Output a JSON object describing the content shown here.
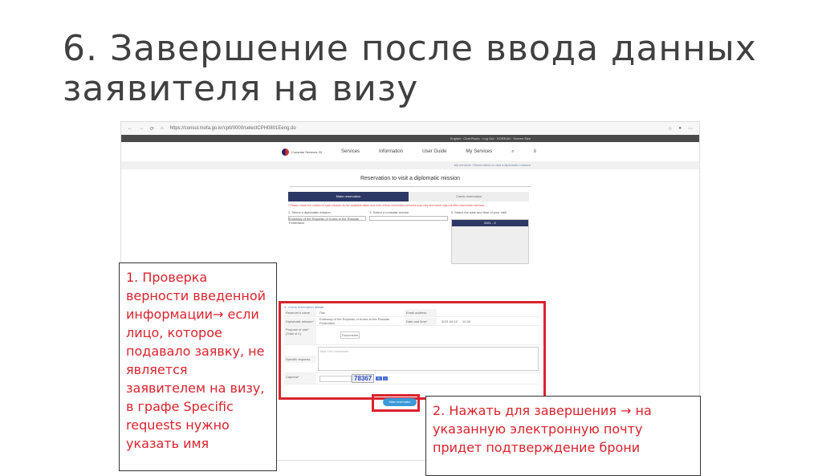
{
  "slide": {
    "title_line1": "6. Завершение после ввода данных",
    "title_line2": "заявителя на визу"
  },
  "browser": {
    "url": "https://consul.mofa.go.kr/cptl/0000/selectCPH0801Eeng.do"
  },
  "site": {
    "top_links": "English · Chat Room · Log Out · KOREAN · Screen Size",
    "logo": "Consular Services 24",
    "nav": [
      "Services",
      "Information",
      "User Guide",
      "My Services"
    ],
    "breadcrumb": "My services / Reservation to visit a diplomatic mission",
    "heading": "Reservation to visit a diplomatic mission",
    "tab_make": "Make reservation",
    "tab_check": "Check reservation",
    "warning": "* Please check the notices of each mission as the available dates and time of their reservation services may vary and some may not offer reservation services.",
    "step1": "1. Select a diplomatic mission",
    "mission": "Embassy of the Republic of Korea to the Russian Federation",
    "step2": "2. Select a consular service",
    "step3": "3. Select the date and time of your visit",
    "calendar_month": "2021 - 9"
  },
  "details": {
    "heading": "4. Check reservation details",
    "reserver_label": "Reserver's name",
    "reserver_value": "Пак",
    "email_label": "Email address",
    "mission_label": "Diplomatic mission*",
    "mission_value": "Embassy of the Republic of Korea to the Russian Federation",
    "date_label": "Date and time*",
    "date_value": "2021.09.10",
    "time_value": "10:30",
    "purpose_label": "Purpose of visit* (Total of 1)",
    "documents_btn": "Documents",
    "requests_label": "Specific requests",
    "requests_placeholder": "Max 100 characters",
    "captcha_label": "Captcha*",
    "captcha_value": "78367",
    "submit": "Make reservation"
  },
  "callouts": {
    "c1": "1. Проверка верности введенной информации→ если лицо, которое подавало заявку, не является заявителем на визу, в графе Specific requests нужно указать имя",
    "c2": "2. Нажать для завершения → на указанную электронную почту придет подтверждение брони"
  }
}
